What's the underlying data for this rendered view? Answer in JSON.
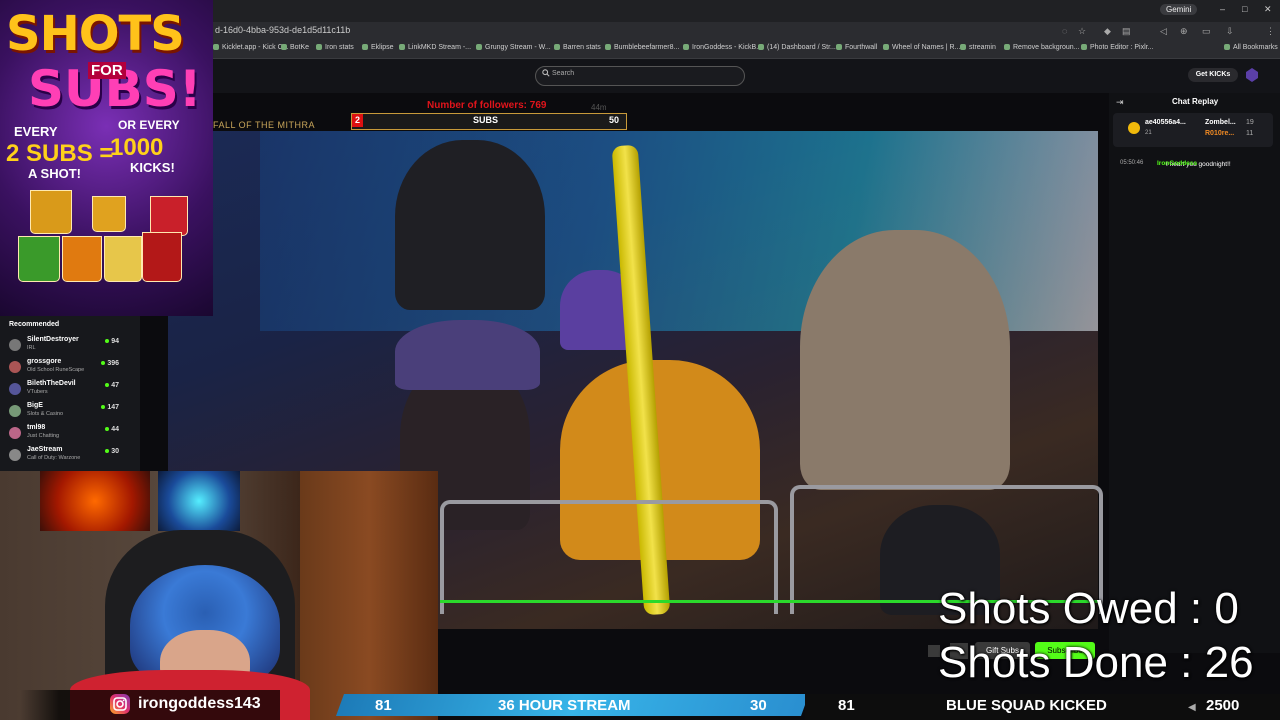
{
  "browser": {
    "url": "d-16d0-4bba-953d-de1d5d11c11b",
    "gemini_label": "Gemini",
    "bookmarks": [
      "Kicklet.app - Kick C...",
      "BotKe",
      "Iron stats",
      "Eklipse",
      "LinkMKD Stream -...",
      "Grungy Stream - W...",
      "Barren stats",
      "Bumblebeefarmer8...",
      "IronGoddess - KickB...",
      "(14) Dashboard / Str...",
      "Fourthwall",
      "Wheel of Names | R...",
      "streamin",
      "Remove backgroun...",
      "Photo Editor : Pixlr...",
      "All Bookmarks"
    ]
  },
  "kick": {
    "search_placeholder": "Search",
    "get_kicks_label": "Get KICKs"
  },
  "promo": {
    "shots": "SHOTS",
    "for": "FOR",
    "subs": "SUBS!",
    "every_left_1": "EVERY",
    "every_left_2": "2 SUBS =",
    "every_left_3": "A SHOT!",
    "or": "OR",
    "every_right_1": "OR EVERY",
    "every_right_2": "1000",
    "every_right_3": "KICKS!"
  },
  "recommended": {
    "title": "Recommended",
    "items": [
      {
        "name": "SilentDestroyer",
        "category": "IRL",
        "viewers": "94"
      },
      {
        "name": "grossgore",
        "category": "Old School RuneScape",
        "viewers": "396"
      },
      {
        "name": "BilethTheDevil",
        "category": "VTubers",
        "viewers": "47"
      },
      {
        "name": "BigE",
        "category": "Slots & Casino",
        "viewers": "147"
      },
      {
        "name": "tml98",
        "category": "Just Chatting",
        "viewers": "44"
      },
      {
        "name": "JaeStream",
        "category": "Call of Duty: Warzone",
        "viewers": "30"
      }
    ]
  },
  "stream_overlay": {
    "title_fragment": "FALL OF THE MITHRA",
    "followers_text": "Number of followers: 769",
    "followers_sub": "44m",
    "subs_current": "2",
    "subs_label": "SUBS",
    "subs_goal": "50",
    "subs_progress": 0.04
  },
  "chat": {
    "title": "Chat Replay",
    "pinned": {
      "a_name": "ae40556a4...",
      "a_value": "21",
      "b1_name": "Zombel...",
      "b1_value": "19",
      "b2_name": "R010re...",
      "b2_value": "11"
    },
    "messages": [
      {
        "time": "05:50:46",
        "user": "IronGoddess",
        "text": "I heart you goodnight!!"
      }
    ]
  },
  "controls": {
    "gift_subs": "Gift Subs",
    "subscribe": "Subscribe"
  },
  "shots": {
    "owed": "Shots Owed : 0",
    "done": "Shots Done : 26"
  },
  "webcam": {
    "handle": "irongoddess143"
  },
  "ticker": {
    "left_count": "81",
    "stream_label": "36 HOUR STREAM",
    "right_count": "30",
    "count2": "81",
    "kicked_label": "BLUE SQUAD KICKED",
    "kicked_value": "2500"
  }
}
